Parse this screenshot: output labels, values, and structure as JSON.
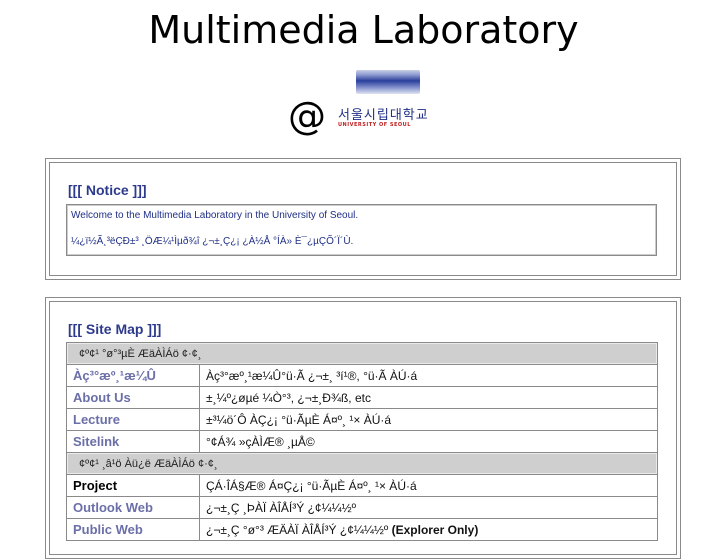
{
  "header": {
    "title": "Multimedia Laboratory",
    "logo_at": "@",
    "logo_korean": "서울시립대학교",
    "logo_english": "UNIVERSITY OF SEOUL"
  },
  "notice": {
    "heading": "[[[ Notice ]]]",
    "line1": "Welcome to the Multimedia Laboratory in the University of Seoul.",
    "line2": "¼¿ï½Ã¸³ëÇÐ±³ ¸ÖÆ¼¹Ìµð¾î ¿¬±¸Ç¿¡ ¿À½Å °ÍÀ» È¯¿µÇÕ´Ï´Ù."
  },
  "sitemap": {
    "heading": "[[[ Site Map ]]]",
    "section1": "¢º¢¹ °ø°³µÈ ÆäÀÌÁö ¢·¢¸",
    "section2": "¢º¢¹ ¸â¹ö Àü¿ë ÆäÀÌÁö ¢·¢¸",
    "rows": [
      {
        "name": "Àç³°æº¸¹æ¼Û",
        "desc": "Àç³°æº¸¹æ¼Û°ü·Ã ¿¬±¸ ³í¹®, °ü·Ã ÀÚ·á"
      },
      {
        "name": "About Us",
        "desc": "±¸¼º¿øµé ¼Ò°³, ¿¬±¸Ð¾ß, etc"
      },
      {
        "name": "Lecture",
        "desc": "±³¼ö´Ô ÀÇ¿¡ °ü·ÃµÈ Á¤º¸ ¹× ÀÚ·á"
      },
      {
        "name": "Sitelink",
        "desc": "°¢Á¾ »çÀÌÆ® ¸µÅ©"
      }
    ],
    "member_rows": [
      {
        "name": "Project",
        "desc": "ÇÁ·ÎÁ§Æ® Á¤Ç¿¡ °ü·ÃµÈ Á¤º¸ ¹× ÀÚ·á"
      },
      {
        "name": "Outlook Web",
        "desc": "¿¬±¸Ç ¸ÞÀÏ ÀÎÅÍ³Ý ¿¢¼¼½º"
      },
      {
        "name": "Public Web",
        "desc": "¿¬±¸Ç °ø°³ ÆÄÀÏ ÀÎÅÍ³Ý ¿¢¼¼½º",
        "desc_bold": "(Explorer Only)"
      }
    ]
  }
}
